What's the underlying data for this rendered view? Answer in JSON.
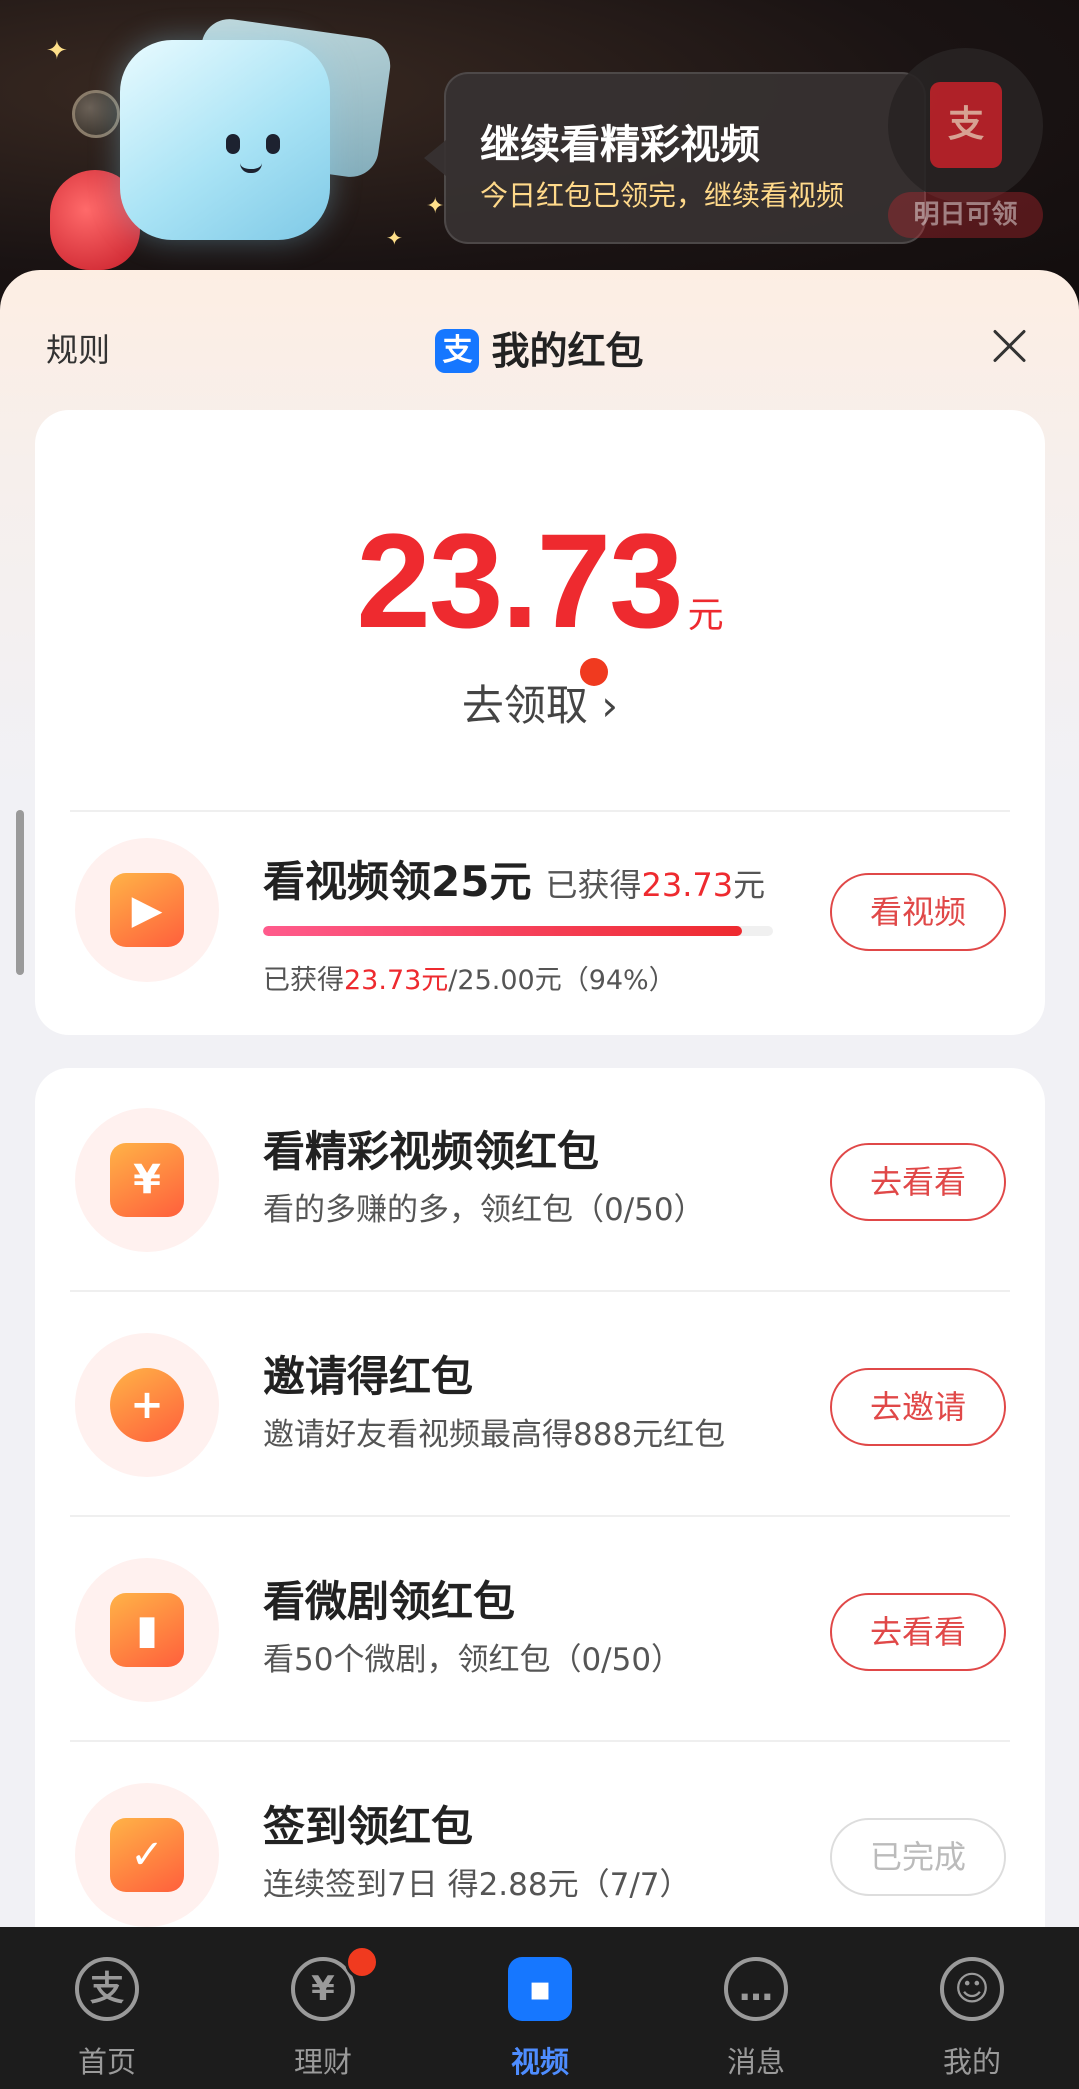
{
  "banner": {
    "title": "继续看精彩视频",
    "subtitle": "今日红包已领完，继续看视频",
    "packet_glyph": "支",
    "tomorrow_label": "明日可领"
  },
  "sheet": {
    "rules_label": "规则",
    "title": "我的红包",
    "logo_glyph": "支"
  },
  "balance": {
    "amount": "23.73",
    "unit": "元",
    "collect_label": "去领取",
    "collect_arrow": "›"
  },
  "progress_task": {
    "title": "看视频领25元",
    "earned_prefix": "已获得",
    "earned_amount": "23.73",
    "earned_unit": "元",
    "progress_percent": 94,
    "detail_prefix": "已获得",
    "detail_amount": "23.73元",
    "detail_suffix": "/25.00元（94%）",
    "button": "看视频",
    "icon": "play-icon"
  },
  "tasks": [
    {
      "title": "看精彩视频领红包",
      "desc": "看的多赚的多，领红包（0/50）",
      "button": "去看看",
      "icon": "yuan-icon",
      "glyph": "¥",
      "done": false
    },
    {
      "title": "邀请得红包",
      "desc": "邀请好友看视频最高得888元红包",
      "button": "去邀请",
      "icon": "invite-user-icon",
      "glyph": "+",
      "done": false
    },
    {
      "title": "看微剧领红包",
      "desc": "看50个微剧，领红包（0/50）",
      "button": "去看看",
      "icon": "tv-icon",
      "glyph": "▮",
      "done": false
    },
    {
      "title": "签到领红包",
      "desc": "连续签到7日 得2.88元（7/7）",
      "button": "已完成",
      "icon": "calendar-check-icon",
      "glyph": "✓",
      "done": true
    }
  ],
  "nav": [
    {
      "label": "首页",
      "icon": "alipay-home-icon",
      "glyph": "支",
      "active": false,
      "badge": false
    },
    {
      "label": "理财",
      "icon": "wealth-yen-icon",
      "glyph": "¥",
      "active": false,
      "badge": true
    },
    {
      "label": "视频",
      "icon": "video-icon",
      "glyph": "▪",
      "active": true,
      "badge": false
    },
    {
      "label": "消息",
      "icon": "message-icon",
      "glyph": "…",
      "active": false,
      "badge": false
    },
    {
      "label": "我的",
      "icon": "profile-icon",
      "glyph": "☺",
      "active": false,
      "badge": false
    }
  ],
  "colors": {
    "accent_red": "#ee2a2f",
    "alipay_blue": "#1677ff",
    "nav_background": "#1c1c1c"
  }
}
